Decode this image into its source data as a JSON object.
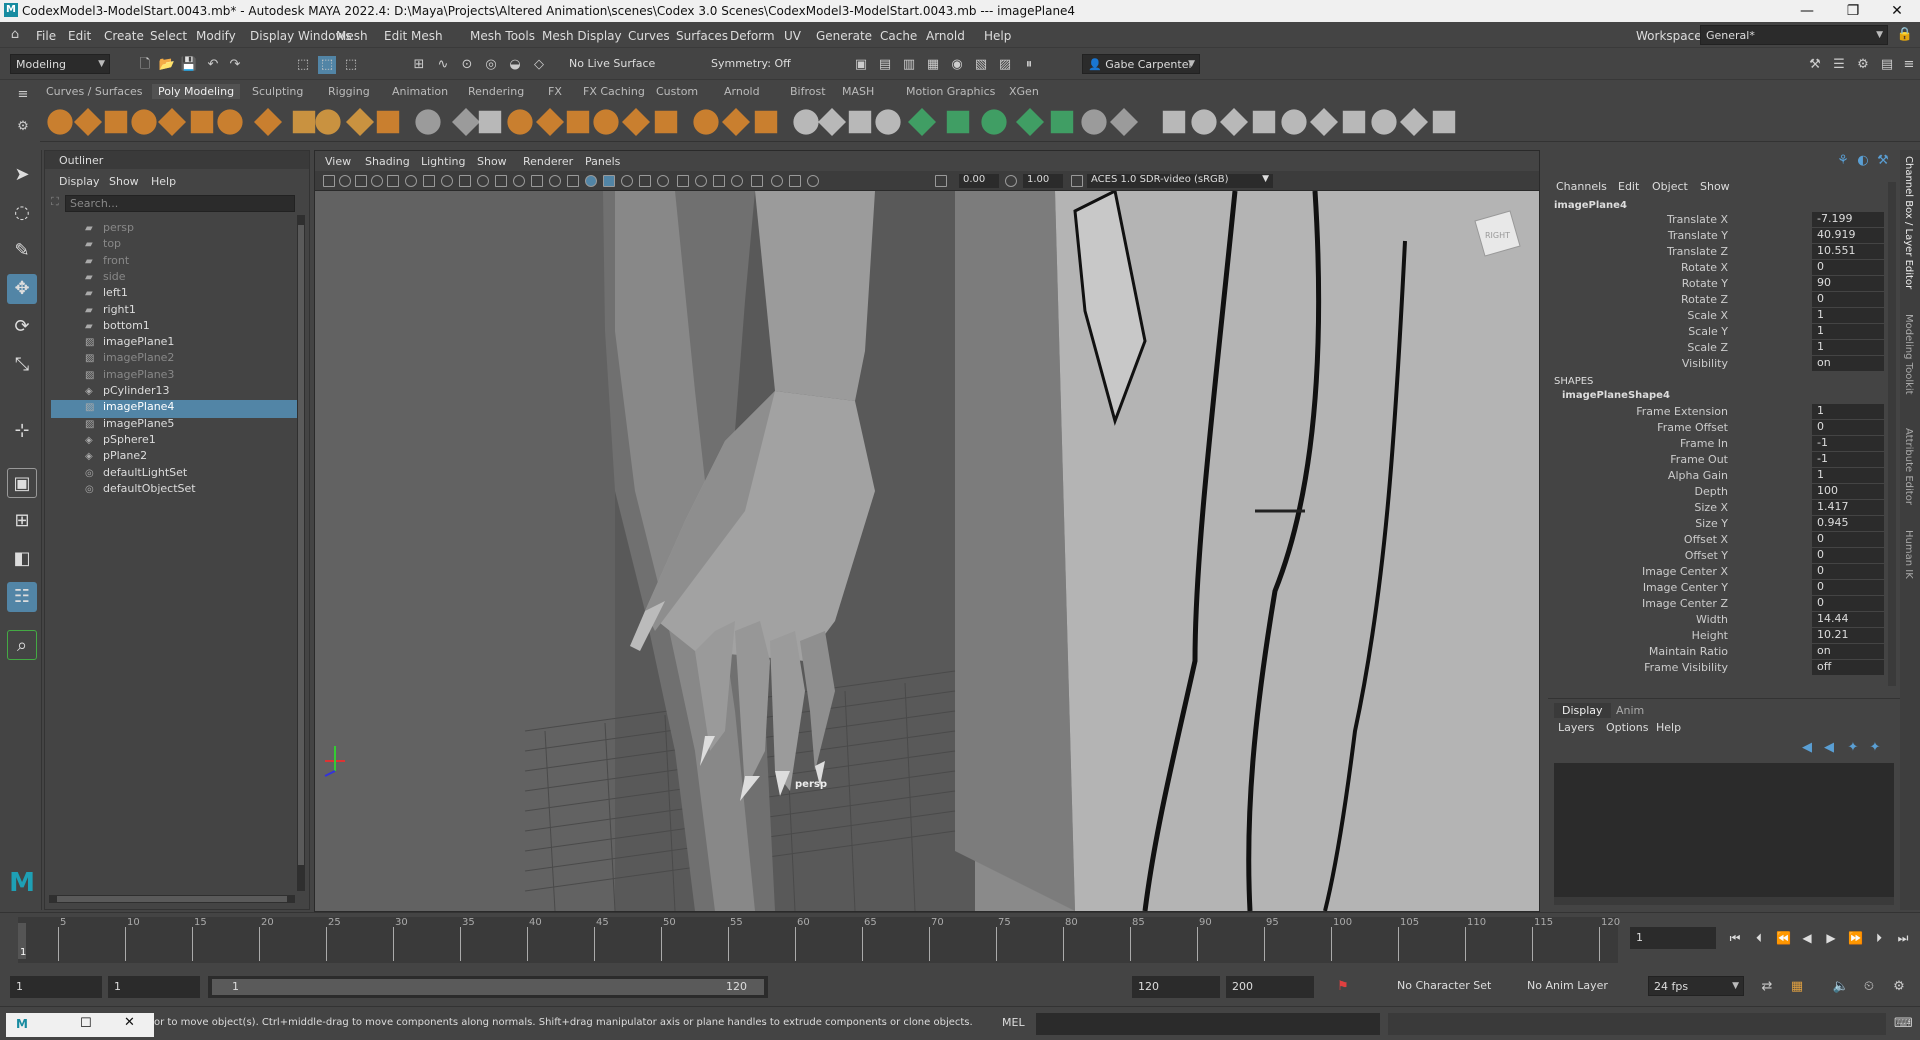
{
  "window": {
    "title": "CodexModel3-ModelStart.0043.mb* - Autodesk MAYA 2022.4: D:\\Maya\\Projects\\Altered Animation\\scenes\\Codex 3.0 Scenes\\CodexModel3-ModelStart.0043.mb  ---  imagePlane4",
    "minimize": "—",
    "restore": "❐",
    "close": "✕"
  },
  "menubar": [
    "File",
    "Edit",
    "Create",
    "Select",
    "Modify",
    "Display",
    "Windows",
    "Mesh",
    "Edit Mesh",
    "Mesh Tools",
    "Mesh Display",
    "Curves",
    "Surfaces",
    "Deform",
    "UV",
    "Generate",
    "Cache",
    "Arnold",
    "Help"
  ],
  "workspace": {
    "label": "Workspace:",
    "value": "General*"
  },
  "status": {
    "menuset": "Modeling",
    "live_surface": "No Live Surface",
    "symmetry": "Symmetry: Off",
    "user": "Gabe Carpenter"
  },
  "shelf_tabs": [
    "Curves / Surfaces",
    "Poly Modeling",
    "Sculpting",
    "Rigging",
    "Animation",
    "Rendering",
    "FX",
    "FX Caching",
    "Custom",
    "Arnold",
    "Bifrost",
    "MASH",
    "Motion Graphics",
    "XGen"
  ],
  "shelf_active": "Poly Modeling",
  "outliner": {
    "title": "Outliner",
    "menus": [
      "Display",
      "Show",
      "Help"
    ],
    "search_placeholder": "Search...",
    "items": [
      {
        "name": "persp",
        "icon": "camera-icon",
        "dim": true,
        "selected": false
      },
      {
        "name": "top",
        "icon": "camera-icon",
        "dim": true,
        "selected": false
      },
      {
        "name": "front",
        "icon": "camera-icon",
        "dim": true,
        "selected": false
      },
      {
        "name": "side",
        "icon": "camera-icon",
        "dim": true,
        "selected": false
      },
      {
        "name": "left1",
        "icon": "camera-icon",
        "dim": false,
        "selected": false
      },
      {
        "name": "right1",
        "icon": "camera-icon",
        "dim": false,
        "selected": false
      },
      {
        "name": "bottom1",
        "icon": "camera-icon",
        "dim": false,
        "selected": false
      },
      {
        "name": "imagePlane1",
        "icon": "image-plane-icon",
        "dim": false,
        "selected": false
      },
      {
        "name": "imagePlane2",
        "icon": "image-plane-icon",
        "dim": true,
        "selected": false
      },
      {
        "name": "imagePlane3",
        "icon": "image-plane-icon",
        "dim": true,
        "selected": false
      },
      {
        "name": "pCylinder13",
        "icon": "mesh-icon",
        "dim": false,
        "selected": false
      },
      {
        "name": "imagePlane4",
        "icon": "image-plane-icon",
        "dim": false,
        "selected": true
      },
      {
        "name": "imagePlane5",
        "icon": "image-plane-icon",
        "dim": false,
        "selected": false
      },
      {
        "name": "pSphere1",
        "icon": "mesh-icon",
        "dim": false,
        "selected": false
      },
      {
        "name": "pPlane2",
        "icon": "mesh-icon",
        "dim": false,
        "selected": false
      },
      {
        "name": "defaultLightSet",
        "icon": "set-icon",
        "dim": false,
        "selected": false
      },
      {
        "name": "defaultObjectSet",
        "icon": "set-icon",
        "dim": false,
        "selected": false
      }
    ]
  },
  "viewport": {
    "menus": [
      "View",
      "Shading",
      "Lighting",
      "Show",
      "Renderer",
      "Panels"
    ],
    "exposure": "0.00",
    "gamma": "1.00",
    "colorspace": "ACES 1.0 SDR-video (sRGB)",
    "camera_label": "persp",
    "viewcube_label": "RIGHT"
  },
  "channelbox": {
    "menus": [
      "Channels",
      "Edit",
      "Object",
      "Show"
    ],
    "object": "imagePlane4",
    "transform": [
      {
        "label": "Translate X",
        "value": "-7.199"
      },
      {
        "label": "Translate Y",
        "value": "40.919"
      },
      {
        "label": "Translate Z",
        "value": "10.551"
      },
      {
        "label": "Rotate X",
        "value": "0"
      },
      {
        "label": "Rotate Y",
        "value": "90"
      },
      {
        "label": "Rotate Z",
        "value": "0"
      },
      {
        "label": "Scale X",
        "value": "1"
      },
      {
        "label": "Scale Y",
        "value": "1"
      },
      {
        "label": "Scale Z",
        "value": "1"
      },
      {
        "label": "Visibility",
        "value": "on"
      }
    ],
    "shapes_header": "SHAPES",
    "shape_name": "imagePlaneShape4",
    "shape_attrs": [
      {
        "label": "Frame Extension",
        "value": "1"
      },
      {
        "label": "Frame Offset",
        "value": "0"
      },
      {
        "label": "Frame In",
        "value": "-1"
      },
      {
        "label": "Frame Out",
        "value": "-1"
      },
      {
        "label": "Alpha Gain",
        "value": "1"
      },
      {
        "label": "Depth",
        "value": "100"
      },
      {
        "label": "Size X",
        "value": "1.417"
      },
      {
        "label": "Size Y",
        "value": "0.945"
      },
      {
        "label": "Offset X",
        "value": "0"
      },
      {
        "label": "Offset Y",
        "value": "0"
      },
      {
        "label": "Image Center X",
        "value": "0"
      },
      {
        "label": "Image Center Y",
        "value": "0"
      },
      {
        "label": "Image Center Z",
        "value": "0"
      },
      {
        "label": "Width",
        "value": "14.44"
      },
      {
        "label": "Height",
        "value": "10.21"
      },
      {
        "label": "Maintain Ratio",
        "value": "on"
      },
      {
        "label": "Frame Visibility",
        "value": "off"
      }
    ]
  },
  "layer_editor": {
    "tabs": [
      "Display",
      "Anim"
    ],
    "menus": [
      "Layers",
      "Options",
      "Help"
    ]
  },
  "right_dock_tabs": [
    "Channel Box / Layer Editor",
    "Modeling Toolkit",
    "Attribute Editor",
    "Human IK"
  ],
  "timeline": {
    "ticks": [
      "5",
      "10",
      "15",
      "20",
      "25",
      "30",
      "35",
      "40",
      "45",
      "50",
      "55",
      "60",
      "65",
      "70",
      "75",
      "80",
      "85",
      "90",
      "95",
      "100",
      "105",
      "110",
      "115",
      "120"
    ],
    "current_frame_label": "1",
    "current_frame_field": "1"
  },
  "range": {
    "start": "1",
    "playback_start": "1",
    "slider_start": "1",
    "slider_end": "120",
    "playback_end": "120",
    "end": "200",
    "character_set": "No Character Set",
    "anim_layer": "No Anim Layer",
    "fps": "24 fps"
  },
  "command": {
    "help_text": "or to move object(s). Ctrl+middle-drag to move components along normals. Shift+drag manipulator axis or plane handles to extrude components or clone objects. Ctrl+Shift+drag to con:",
    "lang": "MEL"
  }
}
